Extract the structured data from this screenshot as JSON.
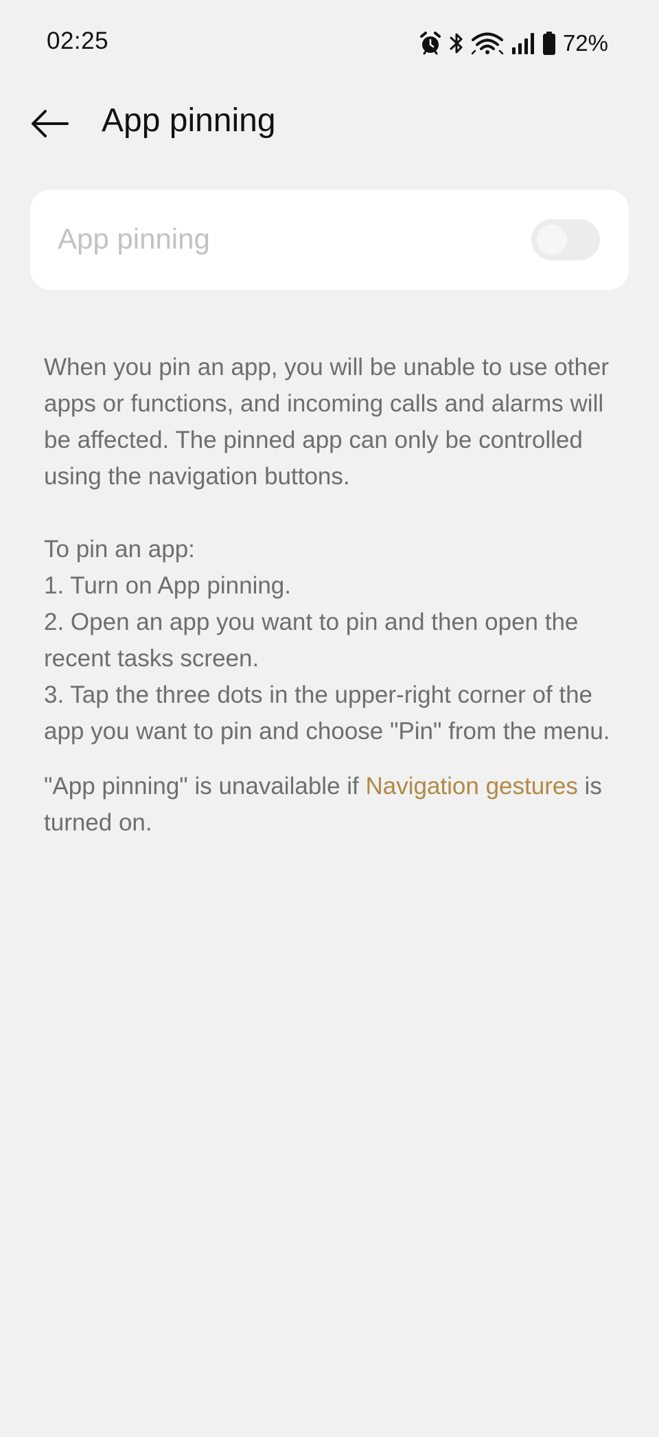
{
  "status_bar": {
    "time": "02:25",
    "battery": "72%",
    "icons": [
      "alarm-icon",
      "bluetooth-icon",
      "wifi-icon",
      "signal-icon",
      "battery-icon"
    ]
  },
  "header": {
    "title": "App pinning",
    "back_icon": "arrow-left-icon"
  },
  "setting": {
    "label": "App pinning",
    "toggle_enabled": false,
    "toggle_disabled": true
  },
  "description": {
    "intro": "When you pin an app, you will be unable to use other apps or functions, and incoming calls and alarms will be affected. The pinned app can only be controlled using the navigation buttons.",
    "steps_heading": "To pin an app:",
    "step_1": "1. Turn on App pinning.",
    "step_2": "2. Open an app you want to pin and then open the recent tasks screen.",
    "step_3": "3. Tap the three dots in the upper-right corner of the app you want to pin and choose \"Pin\" from the menu.",
    "note_prefix": "\"App pinning\" is unavailable if ",
    "note_link": "Navigation gestures",
    "note_suffix": " is turned on."
  },
  "colors": {
    "background": "#f1f1f1",
    "card": "#ffffff",
    "link": "#b08a45",
    "body_text": "#6e6e6e",
    "disabled_label": "#c2c2c2"
  }
}
